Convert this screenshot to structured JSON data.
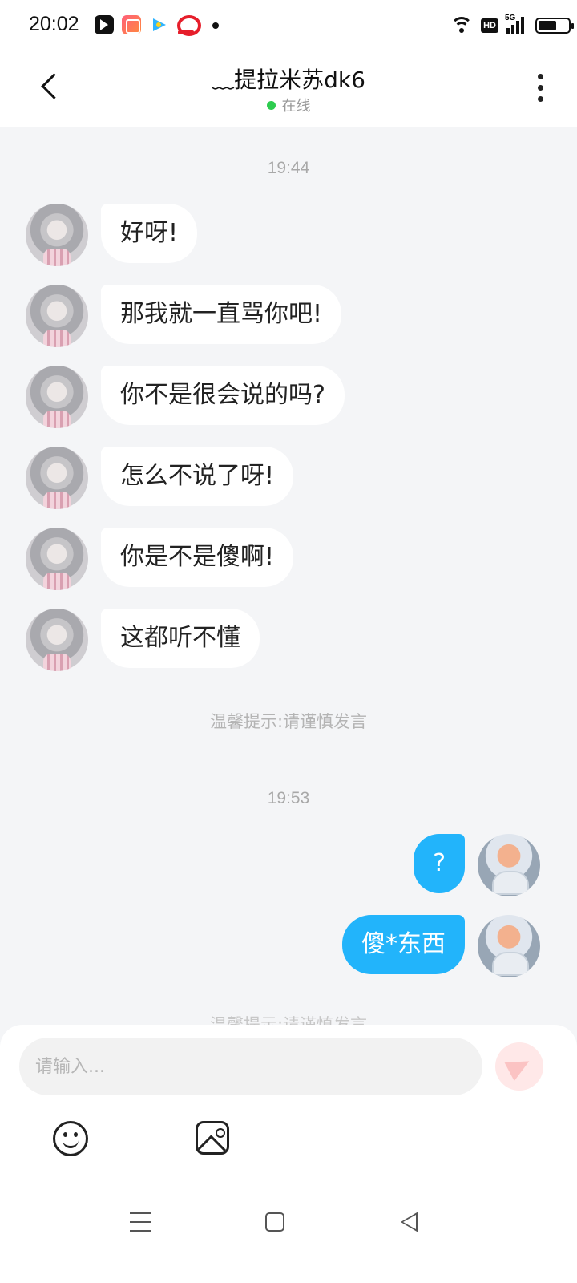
{
  "status_bar": {
    "time": "20:02",
    "hd": "HD",
    "network": "5G",
    "icons": [
      "video-app-icon",
      "gallery-app-icon",
      "player-app-icon",
      "red-app-icon",
      "wifi-icon",
      "signal-icon",
      "battery-icon"
    ]
  },
  "header": {
    "title": "﹏提拉米苏dk6",
    "status": "在线",
    "status_color": "#2dcc4f"
  },
  "messages": {
    "time_1": "19:44",
    "incoming": [
      {
        "text": "好呀!"
      },
      {
        "text": "那我就一直骂你吧!"
      },
      {
        "text": "你不是很会说的吗?"
      },
      {
        "text": "怎么不说了呀!"
      },
      {
        "text": "你是不是傻啊!"
      },
      {
        "text": "这都听不懂"
      }
    ],
    "tip_1": "温馨提示:请谨慎发言",
    "time_2": "19:53",
    "outgoing": [
      {
        "text": "?"
      },
      {
        "text": "傻*东西"
      }
    ],
    "tip_2": "温馨提示:请谨慎发言",
    "outgoing_bubble_color": "#22b4fb"
  },
  "input": {
    "placeholder": "请输入..."
  }
}
